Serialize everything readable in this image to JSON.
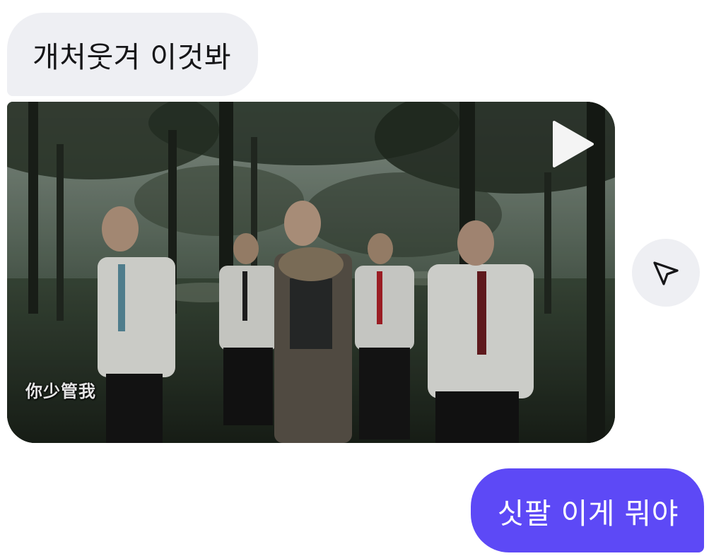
{
  "messages": {
    "incoming_text": "개처웃겨 이것봐",
    "outgoing_text": "싯팔 이게 뭐야"
  },
  "video": {
    "watermark": "你少管我",
    "play_icon": "play-icon",
    "share_icon": "send-icon"
  },
  "colors": {
    "incoming_bubble": "#eeeff3",
    "outgoing_bubble": "#5d49f6",
    "text_dark": "#161618",
    "text_light": "#ffffff"
  }
}
